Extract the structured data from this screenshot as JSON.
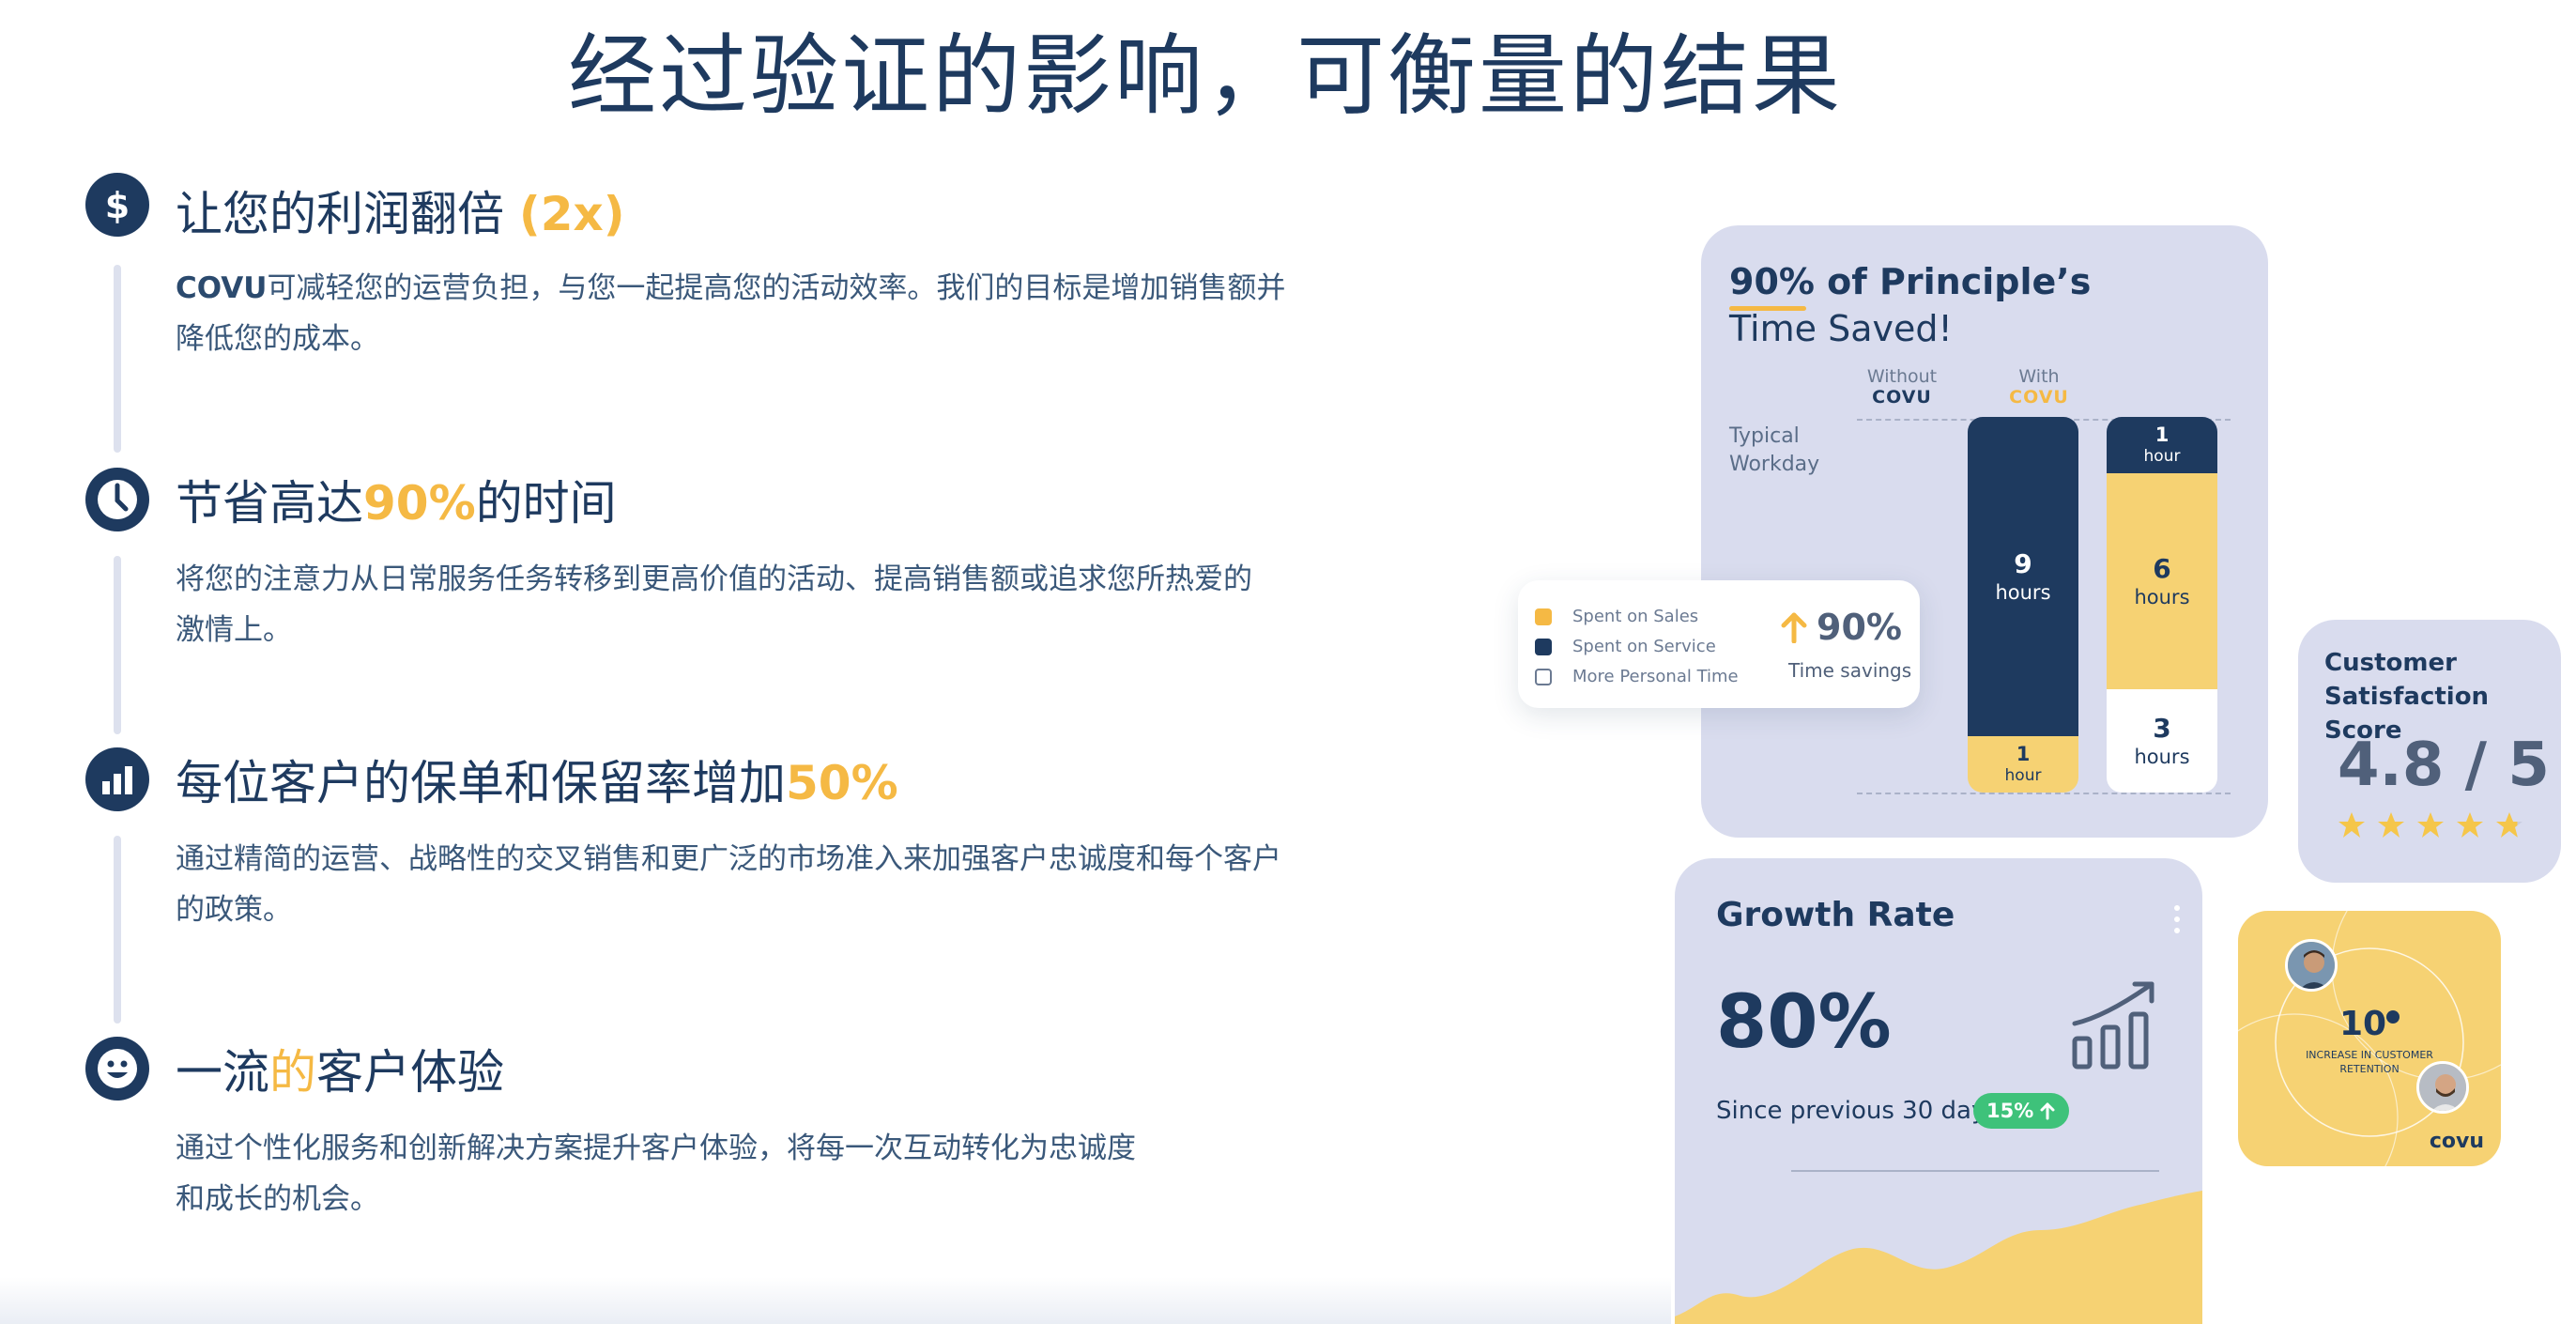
{
  "header": {
    "title": "经过验证的影响，可衡量的结果"
  },
  "features": [
    {
      "icon": "dollar-icon",
      "title_main": "让您的利润翻倍",
      "title_highlight": "(2x)",
      "desc_brand": "COVU",
      "desc_line1": "可减轻您的运营负担，与您一起提高您的活动效率。我们的目标是增加销售额并",
      "desc_line2": "降低您的成本。"
    },
    {
      "icon": "clock-icon",
      "title_pre": "节省高达",
      "title_highlight": "90%",
      "title_post": "的时间",
      "desc_line1": "将您的注意力从日常服务任务转移到更高价值的活动、提高销售额或追求您所热爱的",
      "desc_line2": "激情上。"
    },
    {
      "icon": "bar-chart-icon",
      "title_pre": "每位客户的保单和保留率增加",
      "title_highlight": "50%",
      "desc_line1": "通过精简的运营、战略性的交叉销售和更广泛的市场准入来加强客户忠诚度和每个客户",
      "desc_line2": "的政策。"
    },
    {
      "icon": "smiley-icon",
      "title_pre": "一流",
      "title_highlight": "的",
      "title_post": "客户体验",
      "desc_line1": "通过个性化服务和创新解决方案提升客户体验，将每一次互动转化为忠诚度",
      "desc_line2": "和成长的机会。"
    }
  ],
  "time_saved_card": {
    "title_line1": "90% of Principle’s",
    "title_line2": "Time Saved!",
    "row_label_line1": "Typical",
    "row_label_line2": "Workday",
    "col_without_line1": "Without",
    "col_without_line2": "COVU",
    "col_with_line1": "With",
    "col_with_line2": "COVU",
    "without_navy_num": "9",
    "without_navy_unit": "hours",
    "without_yellow_num": "1",
    "without_yellow_unit": "hour",
    "with_navy_num": "1",
    "with_navy_unit": "hour",
    "with_yellow_num": "6",
    "with_yellow_unit": "hours",
    "with_white_num": "3",
    "with_white_unit": "hours"
  },
  "chart_data": {
    "type": "bar",
    "title": "90% of Principle’s Time Saved!",
    "categories": [
      "Without COVU",
      "With COVU"
    ],
    "series": [
      {
        "name": "Spent on Service",
        "values": [
          9,
          1
        ]
      },
      {
        "name": "Spent on Sales",
        "values": [
          1,
          6
        ]
      },
      {
        "name": "More Personal Time",
        "values": [
          0,
          3
        ]
      }
    ],
    "ylabel": "Typical Workday",
    "stacked": true
  },
  "legend_card": {
    "items": [
      {
        "label": "Spent on Sales",
        "color": "#f5b944"
      },
      {
        "label": "Spent on Service",
        "color": "#1e3a5f"
      },
      {
        "label": "More Personal Time",
        "color": "#ffffff"
      }
    ],
    "savings_value": "90%",
    "savings_label": "Time savings"
  },
  "csat_card": {
    "title_line1": "Customer",
    "title_line2": "Satisfaction Score",
    "score": "4.8 / 5",
    "rating": 4.8,
    "max_rating": 5
  },
  "growth_card": {
    "title": "Growth Rate",
    "value": "80%",
    "since": "Since previous 30 days",
    "badge": "15%"
  },
  "retention_card": {
    "value": "10",
    "label_line1": "INCREASE IN CUSTOMER",
    "label_line2": "RETENTION",
    "brand": "covu"
  },
  "colors": {
    "navy": "#1e3a5f",
    "accent_yellow": "#f5b944",
    "card_bg": "#d9dcee",
    "badge_green": "#3ec27a"
  }
}
